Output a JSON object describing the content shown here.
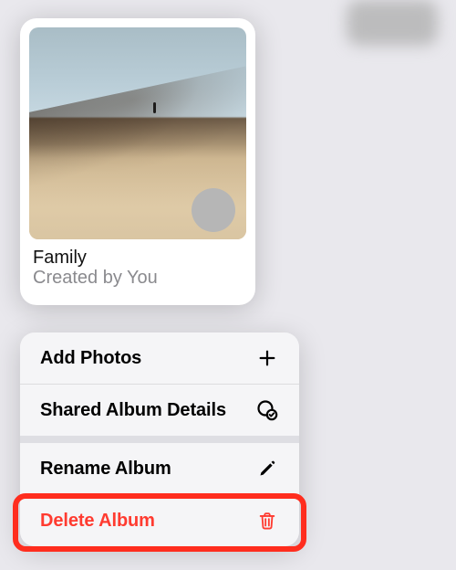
{
  "album": {
    "title": "Family",
    "subtitle": "Created by You"
  },
  "menu": {
    "add_photos": "Add Photos",
    "shared_album_details": "Shared Album Details",
    "rename_album": "Rename Album",
    "delete_album": "Delete Album"
  },
  "colors": {
    "danger": "#ff3b30"
  }
}
